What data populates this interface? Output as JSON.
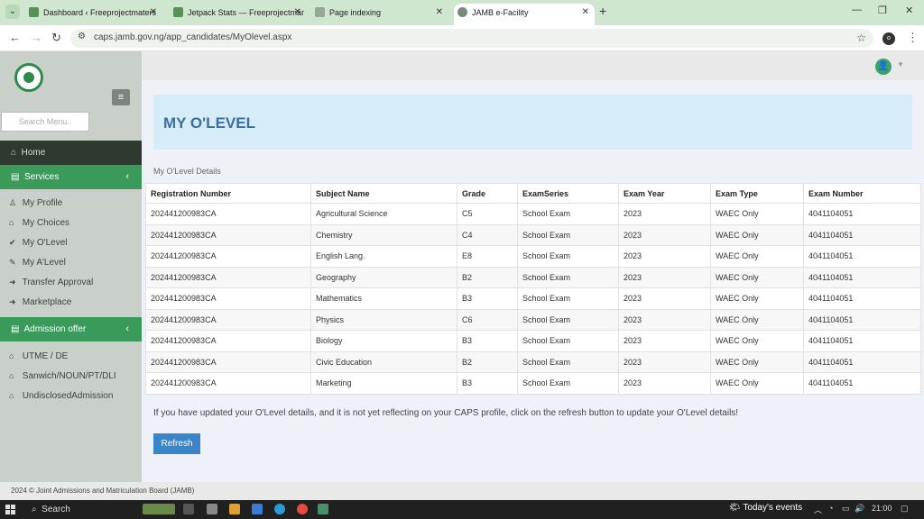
{
  "browser": {
    "tabs": [
      {
        "title": "Dashboard ‹ Freeprojectmaters"
      },
      {
        "title": "Jetpack Stats — Freeprojectmar"
      },
      {
        "title": "Page indexing"
      },
      {
        "title": "JAMB e-Facility"
      }
    ],
    "new_tab": "+",
    "url": "caps.jamb.gov.ng/app_candidates/MyOlevel.aspx",
    "profile_initial": "o"
  },
  "sidebar": {
    "search_placeholder": "Search Menu..",
    "home": "Home",
    "services_label": "Services",
    "services_items": [
      "My Profile",
      "My Choices",
      "My O'Level",
      "My A'Level",
      "Transfer Approval",
      "Marketplace"
    ],
    "admission_label": "Admission offer",
    "admission_items": [
      "UTME / DE",
      "Sanwich/NOUN/PT/DLI",
      "UndisclosedAdmission"
    ]
  },
  "main": {
    "title": "MY O'LEVEL",
    "subtitle": "My O'Level Details",
    "columns": [
      "Registration Number",
      "Subject Name",
      "Grade",
      "ExamSeries",
      "Exam Year",
      "Exam Type",
      "Exam Number"
    ],
    "rows": [
      [
        "202441200983CA",
        "Agricultural Science",
        "C5",
        "School Exam",
        "2023",
        "WAEC Only",
        "4041104051"
      ],
      [
        "202441200983CA",
        "Chemistry",
        "C4",
        "School Exam",
        "2023",
        "WAEC Only",
        "4041104051"
      ],
      [
        "202441200983CA",
        "English Lang.",
        "E8",
        "School Exam",
        "2023",
        "WAEC Only",
        "4041104051"
      ],
      [
        "202441200983CA",
        "Geography",
        "B2",
        "School Exam",
        "2023",
        "WAEC Only",
        "4041104051"
      ],
      [
        "202441200983CA",
        "Mathematics",
        "B3",
        "School Exam",
        "2023",
        "WAEC Only",
        "4041104051"
      ],
      [
        "202441200983CA",
        "Physics",
        "C6",
        "School Exam",
        "2023",
        "WAEC Only",
        "4041104051"
      ],
      [
        "202441200983CA",
        "Biology",
        "B3",
        "School Exam",
        "2023",
        "WAEC Only",
        "4041104051"
      ],
      [
        "202441200983CA",
        "Civic Education",
        "B2",
        "School Exam",
        "2023",
        "WAEC Only",
        "4041104051"
      ],
      [
        "202441200983CA",
        "Marketing",
        "B3",
        "School Exam",
        "2023",
        "WAEC Only",
        "4041104051"
      ]
    ],
    "notice": "If you have updated your O'Level details, and it is not yet reflecting on your CAPS profile, click on the refresh button to update your O'Level details!",
    "refresh_label": "Refresh"
  },
  "footer": {
    "text": "2024 © Joint Admissions and Matriculation Board (JAMB)"
  },
  "taskbar": {
    "search_label": "Search",
    "events_label": "Today's events",
    "time": "21:00"
  },
  "colors": {
    "accent_green": "#3a9a5a",
    "heading_blue": "#3b6ea3",
    "button_blue": "#3a85c9"
  }
}
